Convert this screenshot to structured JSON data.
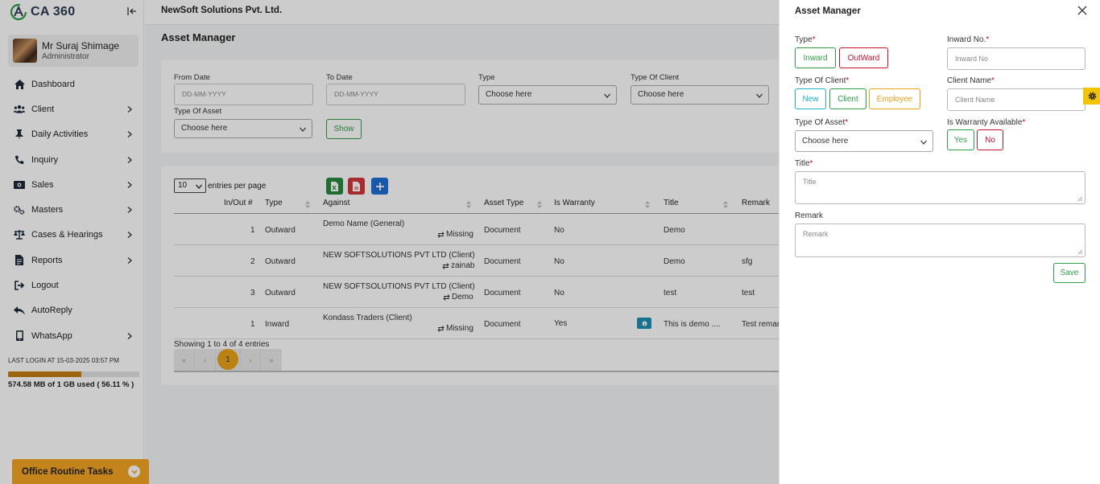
{
  "app": {
    "logo": "CA 360"
  },
  "user": {
    "name": "Mr Suraj Shimage",
    "role": "Administrator"
  },
  "menu": [
    {
      "label": "Dashboard",
      "icon": "home-icon",
      "has_children": false
    },
    {
      "label": "Client",
      "icon": "users-icon",
      "has_children": true
    },
    {
      "label": "Daily Activities",
      "icon": "pin-icon",
      "has_children": true
    },
    {
      "label": "Inquiry",
      "icon": "phone-icon",
      "has_children": true
    },
    {
      "label": "Sales",
      "icon": "money-icon",
      "has_children": true
    },
    {
      "label": "Masters",
      "icon": "gears-icon",
      "has_children": true
    },
    {
      "label": "Cases & Hearings",
      "icon": "scale-icon",
      "has_children": true
    },
    {
      "label": "Reports",
      "icon": "file-icon",
      "has_children": true
    },
    {
      "label": "Logout",
      "icon": "logout-icon",
      "has_children": false
    },
    {
      "label": "AutoReply",
      "icon": "reply-icon",
      "has_children": false
    },
    {
      "label": "WhatsApp",
      "icon": "mobile-icon",
      "has_children": true
    }
  ],
  "footer": {
    "last_login": "LAST LOGIN AT 15-03-2025 03:57 PM",
    "storage_text": "574.58 MB of 1 GB used ( 56.11 % )",
    "storage_fraction": 0.5611,
    "routine_label": "Office Routine Tasks"
  },
  "header": {
    "company": "NewSoft Solutions Pvt. Ltd.",
    "page_title": "Asset Manager"
  },
  "filters": {
    "from_date_label": "From Date",
    "from_date_placeholder": "DD-MM-YYYY",
    "to_date_label": "To Date",
    "to_date_placeholder": "DD-MM-YYYY",
    "type_label": "Type",
    "type_value": "Choose here",
    "type_of_client_label": "Type Of Client",
    "type_of_client_value": "Choose here",
    "type_of_asset_label": "Type Of Asset",
    "type_of_asset_value": "Choose here",
    "show_label": "Show"
  },
  "table": {
    "entries_value": "10",
    "entries_label": "entries per page",
    "columns": [
      "In/Out #",
      "Type",
      "Against",
      "Asset Type",
      "Is Warranty",
      "Title",
      "Remark"
    ],
    "rows": [
      {
        "num": "1",
        "type": "Outward",
        "against": "Demo Name (General)",
        "sub": "Missing",
        "asset_type": "Document",
        "warranty": "No",
        "badge": false,
        "title": "Demo",
        "remark": ""
      },
      {
        "num": "2",
        "type": "Outward",
        "against": "NEW SOFTSOLUTIONS PVT LTD (Client)",
        "sub": "zainab",
        "asset_type": "Document",
        "warranty": "No",
        "badge": false,
        "title": "Demo",
        "remark": "sfg"
      },
      {
        "num": "3",
        "type": "Outward",
        "against": "NEW SOFTSOLUTIONS PVT LTD (Client)",
        "sub": "Demo",
        "asset_type": "Document",
        "warranty": "No",
        "badge": false,
        "title": "test",
        "remark": "test"
      },
      {
        "num": "1",
        "type": "Inward",
        "against": "Kondass Traders (Client)",
        "sub": "Missing",
        "asset_type": "Document",
        "warranty": "Yes",
        "badge": true,
        "title": "This is demo ....",
        "remark": "Test remar"
      }
    ],
    "showing": "Showing 1 to 4 of 4 entries",
    "pagination": {
      "first": "«",
      "prev": "‹",
      "current": "1",
      "next": "›",
      "last": "»"
    }
  },
  "panel": {
    "title": "Asset Manager",
    "type_label": "Type",
    "inward_label": "Inward",
    "outward_label": "OutWard",
    "inward_no_label": "Inward No.",
    "inward_no_placeholder": "Inward No",
    "type_of_client_label": "Type Of Client",
    "new_label": "New",
    "client_label": "Client",
    "employee_label": "Employee",
    "client_name_label": "Client Name",
    "client_name_placeholder": "Client Name",
    "type_of_asset_label": "Type Of Asset",
    "type_of_asset_value": "Choose here",
    "warranty_label": "Is Warranty Available",
    "yes_label": "Yes",
    "no_label": "No",
    "title_label": "Title",
    "title_placeholder": "Title",
    "remark_label": "Remark",
    "remark_placeholder": "Remark",
    "save_label": "Save",
    "required_mark": "*"
  },
  "colors": {
    "green": "#2e9c48",
    "red": "#c5132d",
    "cyan": "#1ab3c7",
    "orange": "#e8a317",
    "accent": "#f6a623"
  }
}
